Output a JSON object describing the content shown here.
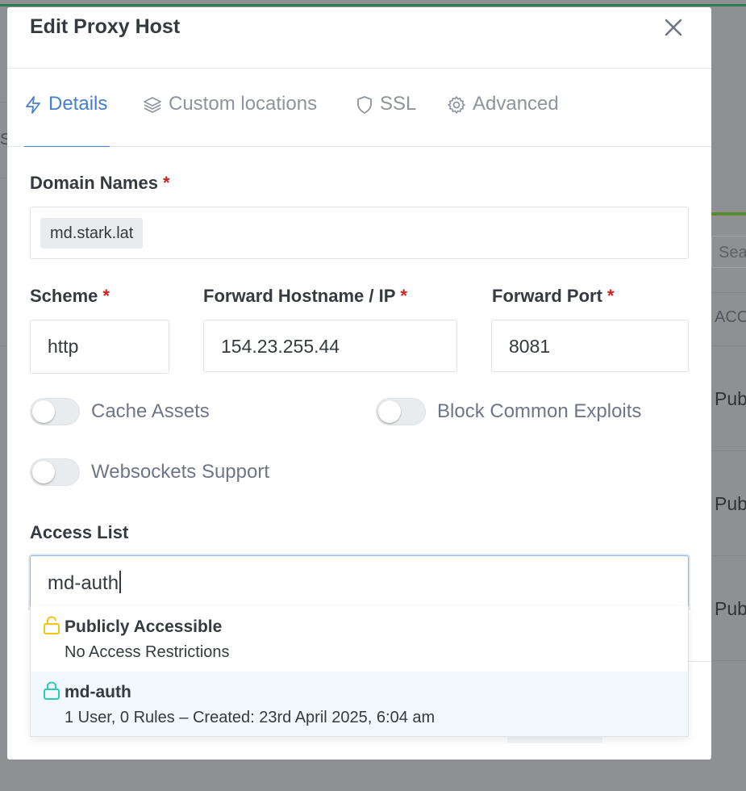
{
  "background": {
    "search_placeholder": "Sea",
    "column_header": "ACC",
    "row_values": [
      "Pub",
      "Pub",
      "Pub"
    ],
    "left_fragment": "SI"
  },
  "modal": {
    "title": "Edit Proxy Host",
    "close_icon": "close-icon",
    "tabs": [
      {
        "label": "Details",
        "icon": "lightning-icon",
        "active": true
      },
      {
        "label": "Custom locations",
        "icon": "layers-icon",
        "active": false
      },
      {
        "label": "SSL",
        "icon": "shield-icon",
        "active": false
      },
      {
        "label": "Advanced",
        "icon": "gear-icon",
        "active": false
      }
    ]
  },
  "form": {
    "domain_names": {
      "label": "Domain Names",
      "required": "*",
      "chips": [
        "md.stark.lat"
      ]
    },
    "scheme": {
      "label": "Scheme",
      "required": "*",
      "value": "http"
    },
    "forward_host": {
      "label": "Forward Hostname / IP",
      "required": "*",
      "value": "154.23.255.44"
    },
    "forward_port": {
      "label": "Forward Port",
      "required": "*",
      "value": "8081"
    },
    "toggles": {
      "cache_assets": {
        "label": "Cache Assets",
        "on": false
      },
      "block_exploits": {
        "label": "Block Common Exploits",
        "on": false
      },
      "websockets": {
        "label": "Websockets Support",
        "on": false
      }
    },
    "access_list": {
      "label": "Access List",
      "value": "md-auth",
      "options": [
        {
          "title": "Publicly Accessible",
          "subtitle": "No Access Restrictions",
          "icon": "unlock-icon",
          "icon_color": "#f1c40f"
        },
        {
          "title": "md-auth",
          "subtitle": "1 User, 0 Rules – Created: 23rd April 2025, 6:04 am",
          "icon": "lock-icon",
          "icon_color": "#2bcbba"
        }
      ]
    }
  },
  "colors": {
    "accent": "#467fcf",
    "required": "#cd201f",
    "top_bar": "#2e7d4f"
  }
}
